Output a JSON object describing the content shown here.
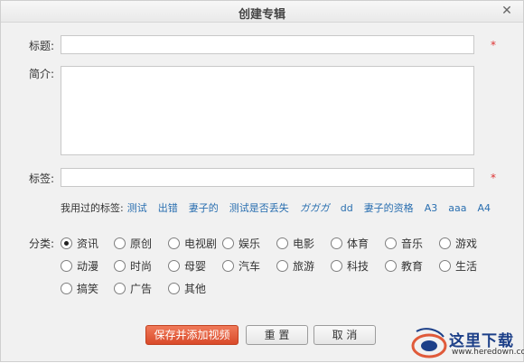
{
  "dialog": {
    "title": "创建专辑",
    "close_glyph": "✕"
  },
  "form": {
    "title_label": "标题:",
    "title_value": "",
    "intro_label": "简介:",
    "intro_value": "",
    "tags_label": "标签:",
    "tags_value": "",
    "required_mark": "*"
  },
  "used_tags": {
    "label": "我用过的标签:",
    "items": [
      "测试",
      "出错",
      "妻子的",
      "测试是否丢失",
      "ガガガ",
      "dd",
      "妻子的资格",
      "A3",
      "aaa",
      "A4"
    ]
  },
  "category": {
    "label": "分类:",
    "selected": "资讯",
    "options": [
      "资讯",
      "原创",
      "电视剧",
      "娱乐",
      "电影",
      "体育",
      "音乐",
      "游戏",
      "动漫",
      "时尚",
      "母婴",
      "汽车",
      "旅游",
      "科技",
      "教育",
      "生活",
      "搞笑",
      "广告",
      "其他"
    ]
  },
  "buttons": {
    "save_add_video": "保存并添加视频",
    "reset": "重 置",
    "cancel": "取 消"
  },
  "watermark": {
    "text": "这里下载",
    "url": "www.heredown.com"
  },
  "colors": {
    "primary_button": "#e05a3a",
    "tag_link": "#2a6fb0",
    "required": "#d33333",
    "watermark_text": "#1c3f88"
  }
}
